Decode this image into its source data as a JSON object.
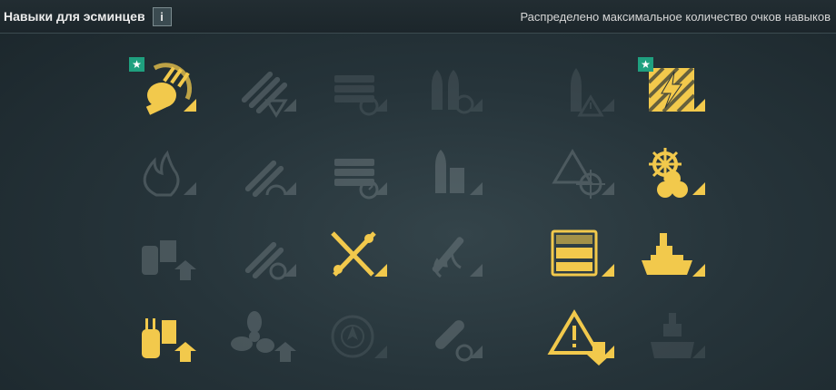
{
  "header": {
    "title": "Навыки для эсминцев",
    "info_label": "i",
    "status": "Распределено максимальное количество очков навыков"
  },
  "colors": {
    "active": "#f2c94c",
    "inactive": "#8a9599",
    "star_badge": "#1fa07f"
  },
  "skills": [
    {
      "row": 1,
      "col": 1,
      "icon": "gun-turret-speed-icon",
      "active": true,
      "starred": true
    },
    {
      "row": 1,
      "col": 2,
      "icon": "torpedo-reload-icon",
      "active": false
    },
    {
      "row": 1,
      "col": 3,
      "icon": "consumables-reload-icon",
      "active": false
    },
    {
      "row": 1,
      "col": 4,
      "icon": "shells-reload-icon",
      "active": false
    },
    {
      "row": 1,
      "col": 5,
      "icon": "shell-warning-icon",
      "active": false
    },
    {
      "row": 1,
      "col": 6,
      "icon": "electrical-hazard-icon",
      "active": true,
      "starred": true
    },
    {
      "row": 2,
      "col": 1,
      "icon": "fire-icon",
      "active": false
    },
    {
      "row": 2,
      "col": 2,
      "icon": "torpedo-speed-icon",
      "active": false
    },
    {
      "row": 2,
      "col": 3,
      "icon": "consumables-duration-icon",
      "active": false
    },
    {
      "row": 2,
      "col": 4,
      "icon": "shell-stack-icon",
      "active": false
    },
    {
      "row": 2,
      "col": 5,
      "icon": "detection-warning-icon",
      "active": false
    },
    {
      "row": 2,
      "col": 6,
      "icon": "helm-propeller-icon",
      "active": true
    },
    {
      "row": 3,
      "col": 1,
      "icon": "secondary-turret-upgrade-icon",
      "active": false
    },
    {
      "row": 3,
      "col": 2,
      "icon": "torpedo-armament-icon",
      "active": false
    },
    {
      "row": 3,
      "col": 3,
      "icon": "crossed-tools-icon",
      "active": true
    },
    {
      "row": 3,
      "col": 4,
      "icon": "firefighting-icon",
      "active": false
    },
    {
      "row": 3,
      "col": 5,
      "icon": "extra-consumables-icon",
      "active": true
    },
    {
      "row": 3,
      "col": 6,
      "icon": "ship-survivability-icon",
      "active": true
    },
    {
      "row": 4,
      "col": 1,
      "icon": "turret-upgrade-icon",
      "active": true
    },
    {
      "row": 4,
      "col": 2,
      "icon": "propulsion-upgrade-icon",
      "active": false
    },
    {
      "row": 4,
      "col": 3,
      "icon": "radar-compass-icon",
      "active": false
    },
    {
      "row": 4,
      "col": 4,
      "icon": "depth-charge-icon",
      "active": false
    },
    {
      "row": 4,
      "col": 5,
      "icon": "concealment-warning-icon",
      "active": true
    },
    {
      "row": 4,
      "col": 6,
      "icon": "ship-silhouette-icon",
      "active": false
    }
  ]
}
